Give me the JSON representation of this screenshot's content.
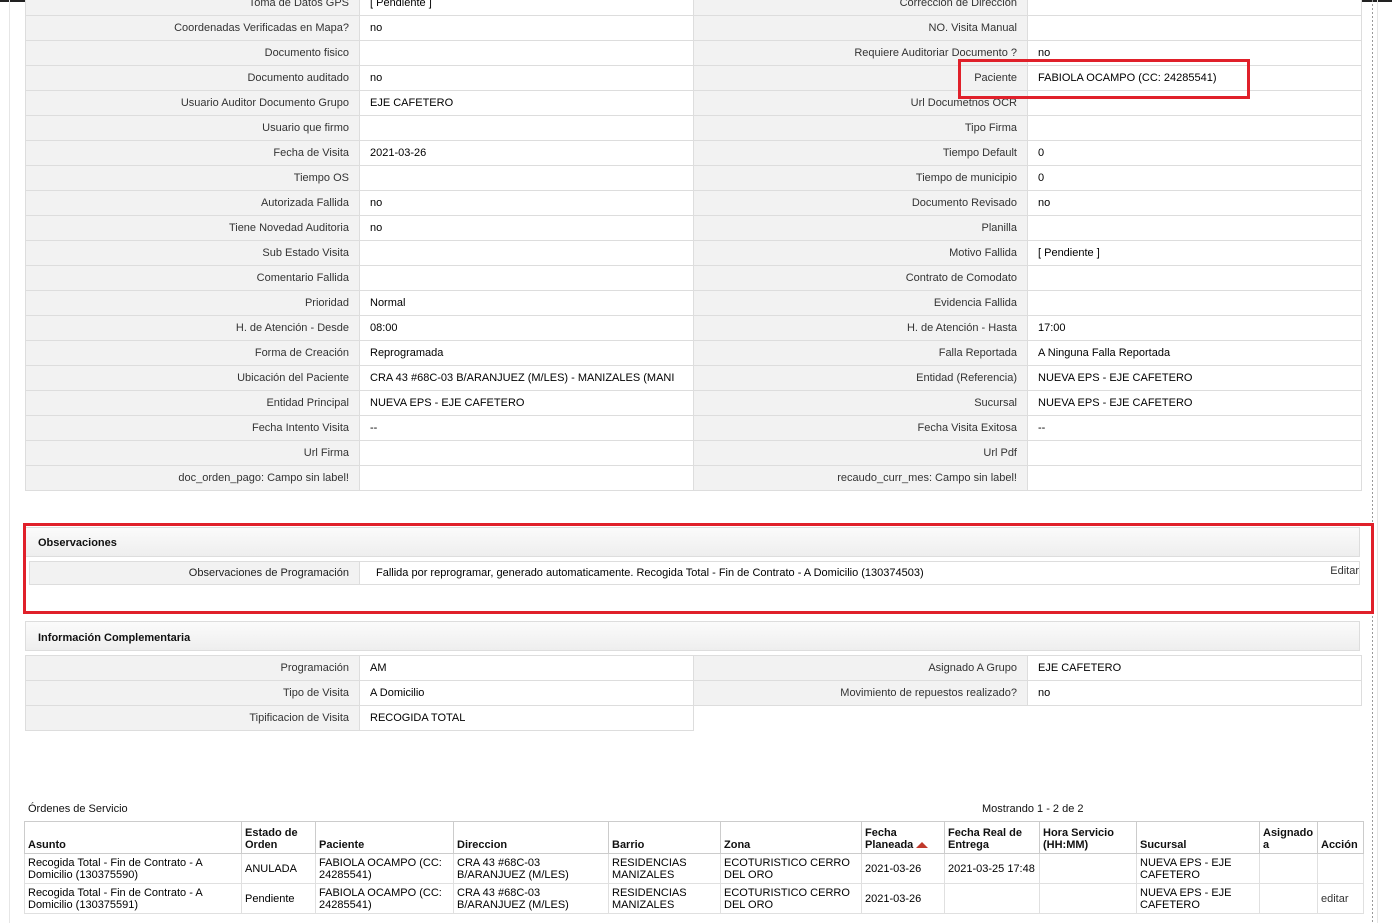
{
  "main_rows": [
    {
      "l1": "Toma de Datos GPS",
      "v1": "[ Pendiente ]",
      "l2": "Correccion de Direccion",
      "v2": ""
    },
    {
      "l1": "Coordenadas Verificadas en Mapa?",
      "v1": "no",
      "l2": "NO. Visita Manual",
      "v2": ""
    },
    {
      "l1": "Documento fisico",
      "v1": "",
      "l2": "Requiere Auditoriar Documento ?",
      "v2": "no"
    },
    {
      "l1": "Documento auditado",
      "v1": "no",
      "l2": "Paciente",
      "v2": "FABIOLA OCAMPO (CC: 24285541)"
    },
    {
      "l1": "Usuario Auditor Documento Grupo",
      "v1": "EJE CAFETERO",
      "l2": "Url Documetnos OCR",
      "v2": ""
    },
    {
      "l1": "Usuario que firmo",
      "v1": "",
      "l2": "Tipo Firma",
      "v2": ""
    },
    {
      "l1": "Fecha de Visita",
      "v1": "2021-03-26",
      "l2": "Tiempo Default",
      "v2": "0"
    },
    {
      "l1": "Tiempo OS",
      "v1": "",
      "l2": "Tiempo de municipio",
      "v2": "0"
    },
    {
      "l1": "Autorizada Fallida",
      "v1": "no",
      "l2": "Documento Revisado",
      "v2": "no"
    },
    {
      "l1": "Tiene Novedad Auditoria",
      "v1": "no",
      "l2": "Planilla",
      "v2": ""
    },
    {
      "l1": "Sub Estado Visita",
      "v1": "",
      "l2": "Motivo Fallida",
      "v2": "[ Pendiente ]"
    },
    {
      "l1": "Comentario Fallida",
      "v1": "",
      "l2": "Contrato de Comodato",
      "v2": ""
    },
    {
      "l1": "Prioridad",
      "v1": "Normal",
      "l2": "Evidencia Fallida",
      "v2": ""
    },
    {
      "l1": "H. de Atención - Desde",
      "v1": "08:00",
      "l2": "H. de Atención - Hasta",
      "v2": "17:00"
    },
    {
      "l1": "Forma de Creación",
      "v1": "Reprogramada",
      "l2": "Falla Reportada",
      "v2": "A Ninguna Falla Reportada"
    },
    {
      "l1": "Ubicación del Paciente",
      "v1": "CRA 43 #68C-03 B/ARANJUEZ (M/LES) - MANIZALES (MANI",
      "l2": "Entidad (Referencia)",
      "v2": "NUEVA EPS - EJE CAFETERO"
    },
    {
      "l1": "Entidad Principal",
      "v1": "NUEVA EPS - EJE CAFETERO",
      "l2": "Sucursal",
      "v2": "NUEVA EPS - EJE CAFETERO"
    },
    {
      "l1": "Fecha Intento Visita",
      "v1": "--",
      "l2": "Fecha Visita Exitosa",
      "v2": "--"
    },
    {
      "l1": "Url Firma",
      "v1": "",
      "l2": "Url Pdf",
      "v2": ""
    },
    {
      "l1": "doc_orden_pago: Campo sin label!",
      "v1": "",
      "l2": "recaudo_curr_mes: Campo sin label!",
      "v2": ""
    }
  ],
  "observaciones": {
    "title": "Observaciones",
    "label": "Observaciones de Programación",
    "value": "Fallida por reprogramar, generado automaticamente. Recogida Total - Fin de Contrato - A Domicilio (130374503)",
    "edit": "Editar"
  },
  "info_comp": {
    "title": "Información Complementaria",
    "rows": [
      {
        "l1": "Programación",
        "v1": "AM",
        "l2": "Asignado A Grupo",
        "v2": "EJE CAFETERO"
      },
      {
        "l1": "Tipo de Visita",
        "v1": "A Domicilio",
        "l2": "Movimiento de repuestos realizado?",
        "v2": "no"
      },
      {
        "l1": "Tipificacion de Visita",
        "v1": "RECOGIDA TOTAL"
      }
    ]
  },
  "ordenes": {
    "title": "Órdenes de Servicio",
    "count": "Mostrando 1 - 2 de 2",
    "headers": [
      "Asunto",
      "Estado de Orden",
      "Paciente",
      "Direccion",
      "Barrio",
      "Zona",
      "Fecha Planeada",
      "Fecha Real de Entrega",
      "Hora Servicio (HH:MM)",
      "Sucursal",
      "Asignado a",
      "Acción"
    ],
    "rows": [
      {
        "asunto": "Recogida Total - Fin de Contrato - A Domicilio (130375590)",
        "estado": "ANULADA",
        "paciente": "FABIOLA OCAMPO (CC: 24285541)",
        "direccion": "CRA 43 #68C-03 B/ARANJUEZ (M/LES)",
        "barrio": "RESIDENCIAS MANIZALES",
        "zona": "ECOTURISTICO CERRO DEL ORO",
        "fecha_planeada": "2021-03-26",
        "fecha_real": "2021-03-25 17:48",
        "hora": "",
        "sucursal": "NUEVA EPS - EJE CAFETERO",
        "asignado": "",
        "accion": ""
      },
      {
        "asunto": "Recogida Total - Fin de Contrato - A Domicilio (130375591)",
        "estado": "Pendiente",
        "paciente": "FABIOLA OCAMPO (CC: 24285541)",
        "direccion": "CRA 43 #68C-03 B/ARANJUEZ (M/LES)",
        "barrio": "RESIDENCIAS MANIZALES",
        "zona": "ECOTURISTICO CERRO DEL ORO",
        "fecha_planeada": "2021-03-26",
        "fecha_real": "",
        "hora": "",
        "sucursal": "NUEVA EPS - EJE CAFETERO",
        "asignado": "",
        "accion": "editar"
      }
    ]
  },
  "colors": {
    "highlight": "#e0202a",
    "sort_arrow": "#c0392b"
  }
}
